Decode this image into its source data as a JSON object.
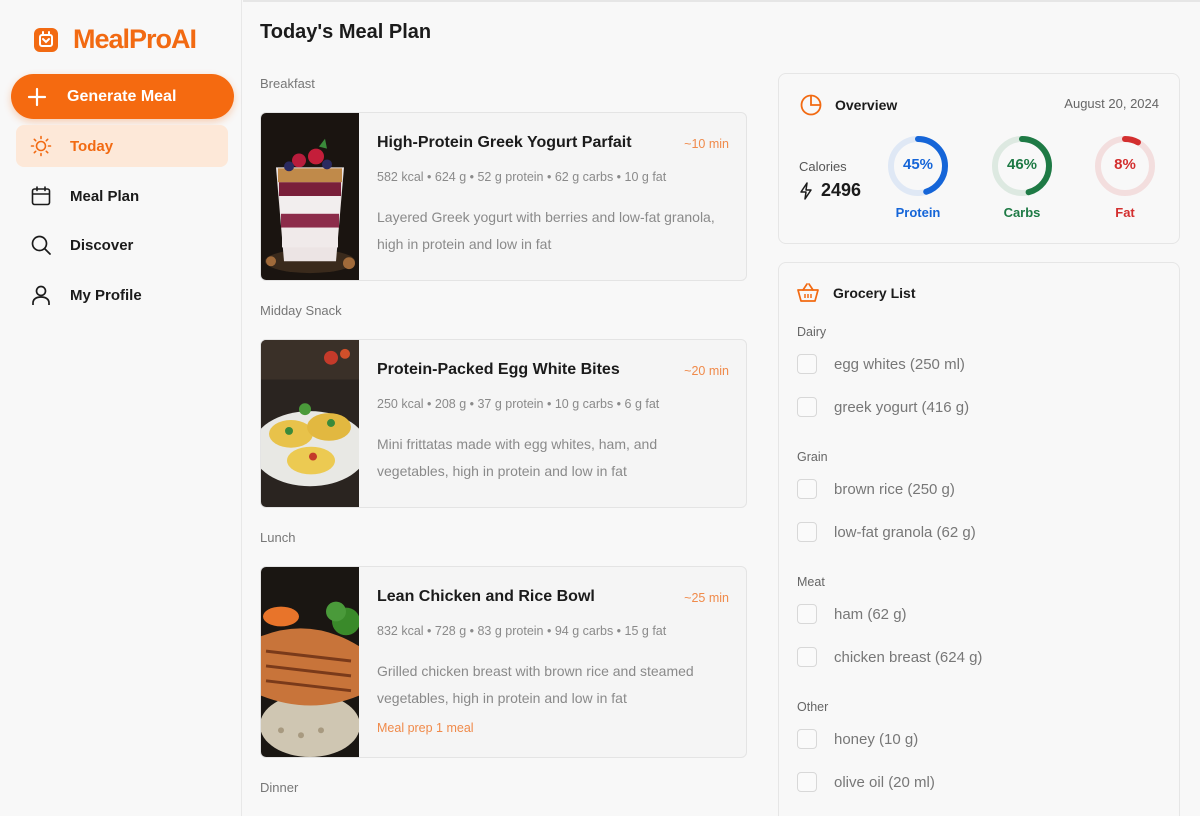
{
  "app": {
    "name": "MealProAI"
  },
  "sidebar": {
    "generate_label": "Generate Meal",
    "items": [
      {
        "label": "Today",
        "icon": "sun-icon",
        "active": true
      },
      {
        "label": "Meal Plan",
        "icon": "calendar-icon",
        "active": false
      },
      {
        "label": "Discover",
        "icon": "search-icon",
        "active": false
      },
      {
        "label": "My Profile",
        "icon": "user-icon",
        "active": false
      }
    ]
  },
  "main": {
    "title": "Today's Meal Plan",
    "sections": [
      {
        "label": "Breakfast",
        "meal": {
          "title": "High-Protein Greek Yogurt Parfait",
          "time": "~10 min",
          "stats": "582 kcal • 624 g • 52 g protein • 62 g carbs • 10 g fat",
          "description": "Layered Greek yogurt with berries and low-fat granola, high in protein and low in fat",
          "image": "yogurt-parfait-photo"
        }
      },
      {
        "label": "Midday Snack",
        "meal": {
          "title": "Protein-Packed Egg White Bites",
          "time": "~20 min",
          "stats": "250 kcal • 208 g • 37 g protein • 10 g carbs • 6 g fat",
          "description": "Mini frittatas made with egg whites, ham, and vegetables, high in protein and low in fat",
          "image": "egg-bites-photo"
        }
      },
      {
        "label": "Lunch",
        "meal": {
          "title": "Lean Chicken and Rice Bowl",
          "time": "~25 min",
          "stats": "832 kcal • 728 g • 83 g protein • 94 g carbs • 15 g fat",
          "description": "Grilled chicken breast with brown rice and steamed vegetables, high in protein and low in fat",
          "prep": "Meal prep 1 meal",
          "image": "chicken-bowl-photo"
        }
      },
      {
        "label": "Dinner"
      }
    ]
  },
  "overview": {
    "title": "Overview",
    "date": "August 20, 2024",
    "calories_label": "Calories",
    "calories_value": "2496",
    "macros": [
      {
        "label": "Protein",
        "pct_text": "45%",
        "pct": 45,
        "color": "#1565d8"
      },
      {
        "label": "Carbs",
        "pct_text": "46%",
        "pct": 46,
        "color": "#1e7a45"
      },
      {
        "label": "Fat",
        "pct_text": "8%",
        "pct": 8,
        "color": "#d32f2f"
      }
    ]
  },
  "grocery": {
    "title": "Grocery List",
    "categories": [
      {
        "name": "Dairy",
        "items": [
          "egg whites (250 ml)",
          "greek yogurt (416 g)"
        ]
      },
      {
        "name": "Grain",
        "items": [
          "brown rice (250 g)",
          "low-fat granola (62 g)"
        ]
      },
      {
        "name": "Meat",
        "items": [
          "ham (62 g)",
          "chicken breast (624 g)"
        ]
      },
      {
        "name": "Other",
        "items": [
          "honey (10 g)",
          "olive oil (20 ml)"
        ]
      }
    ]
  },
  "colors": {
    "accent": "#f56a10",
    "active_bg": "#fde8d8"
  }
}
